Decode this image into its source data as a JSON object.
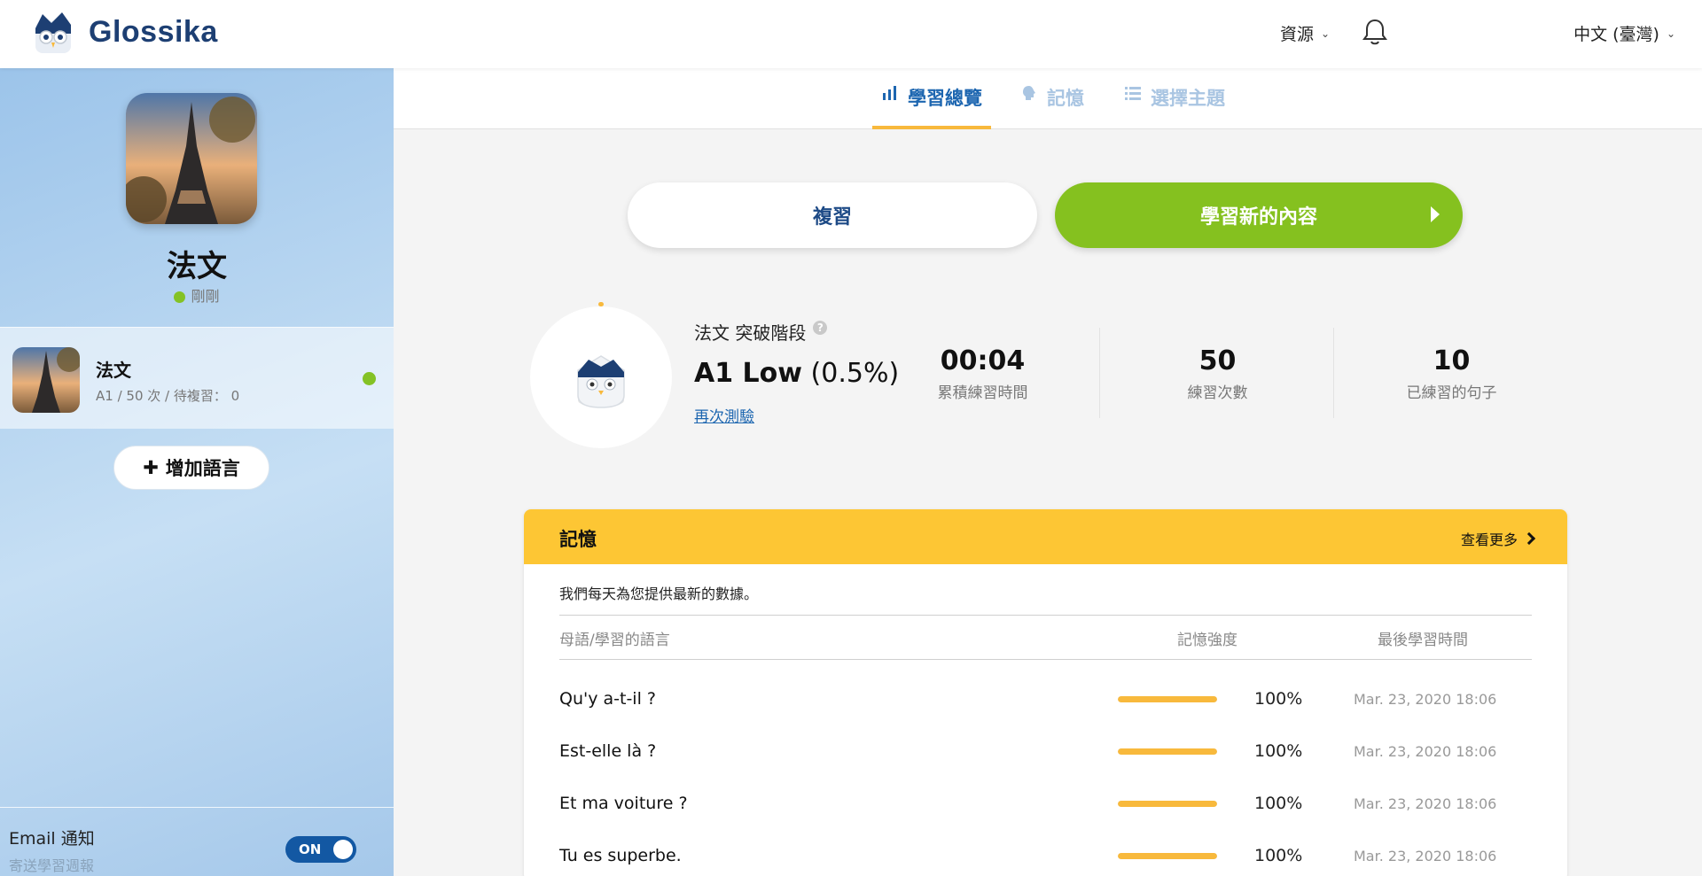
{
  "header": {
    "logo_text": "Glossika",
    "resources_label": "資源",
    "language_label": "中文 (臺灣)"
  },
  "sidebar": {
    "title": "法文",
    "status": "剛剛",
    "item": {
      "name": "法文",
      "meta": "A1 / 50 次 / 待複習： 0"
    },
    "add_language_label": "增加語言",
    "email": {
      "title": "Email 通知",
      "subtitle": "寄送學習週報",
      "toggle_label": "ON"
    }
  },
  "tabs": [
    {
      "label": "學習總覽",
      "icon": "bar-chart-icon"
    },
    {
      "label": "記憶",
      "icon": "brain-icon"
    },
    {
      "label": "選擇主題",
      "icon": "list-icon"
    }
  ],
  "actions": {
    "review_label": "複習",
    "learn_label": "學習新的內容"
  },
  "level": {
    "label": "法文 突破階段",
    "level_name": "A1 Low",
    "level_pct": "(0.5%)",
    "retest_label": "再次測驗"
  },
  "stats": [
    {
      "value": "00:04",
      "label": "累積練習時間"
    },
    {
      "value": "50",
      "label": "練習次數"
    },
    {
      "value": "10",
      "label": "已練習的句子"
    }
  ],
  "memory": {
    "title": "記憶",
    "more_label": "查看更多",
    "description": "我們每天為您提供最新的數據。",
    "columns": [
      "母語/學習的語言",
      "記憶強度",
      "最後學習時間"
    ],
    "rows": [
      {
        "text": "Qu'y a-t-il ?",
        "strength": 100,
        "strength_label": "100%",
        "time": "Mar. 23, 2020 18:06"
      },
      {
        "text": "Est-elle là ?",
        "strength": 100,
        "strength_label": "100%",
        "time": "Mar. 23, 2020 18:06"
      },
      {
        "text": "Et ma voiture ?",
        "strength": 100,
        "strength_label": "100%",
        "time": "Mar. 23, 2020 18:06"
      },
      {
        "text": "Tu es superbe.",
        "strength": 100,
        "strength_label": "100%",
        "time": "Mar. 23, 2020 18:06"
      }
    ]
  },
  "colors": {
    "brand_blue": "#1d3f73",
    "accent_green": "#85c11f",
    "accent_yellow": "#fdc634",
    "link_blue": "#1d66b0"
  }
}
